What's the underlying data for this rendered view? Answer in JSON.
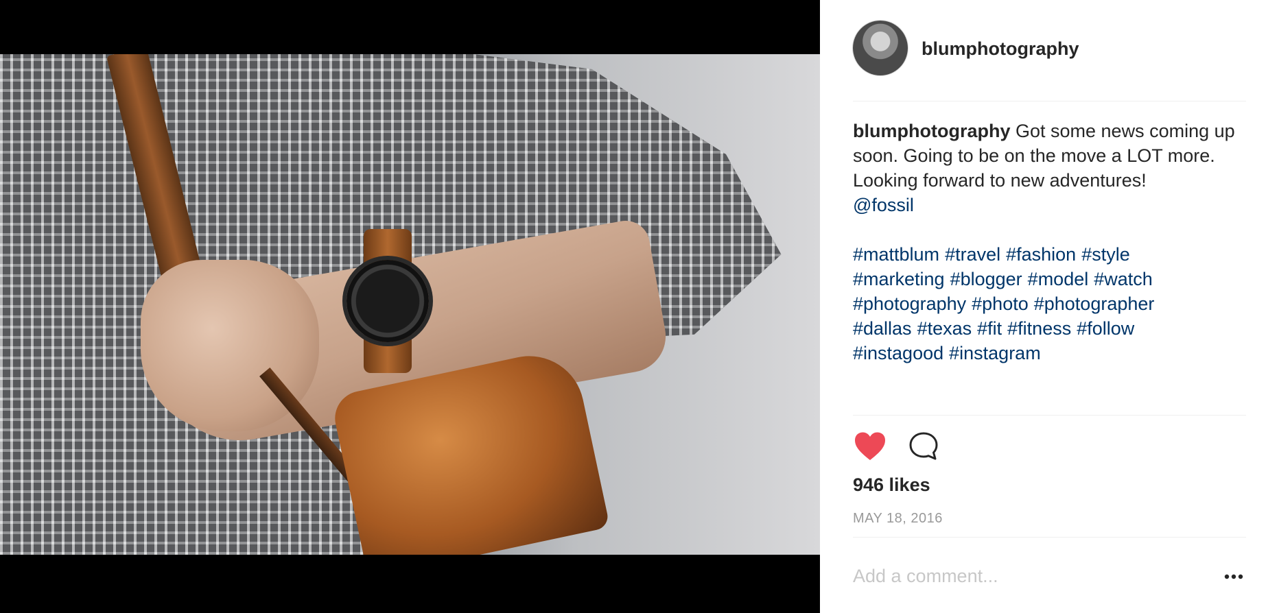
{
  "post": {
    "username": "blumphotography",
    "caption": {
      "username": "blumphotography",
      "text": "Got some news coming up soon. Going to be on the move a LOT more. Looking forward to new adventures!",
      "mention": "@fossil",
      "hashtags": [
        "#mattblum",
        "#travel",
        "#fashion",
        "#style",
        "#marketing",
        "#blogger",
        "#model",
        "#watch",
        "#photography",
        "#photo",
        "#photographer",
        "#dallas",
        "#texas",
        "#fit",
        "#fitness",
        "#follow",
        "#instagood",
        "#instagram"
      ]
    },
    "likes": "946 likes",
    "date": "MAY 18, 2016"
  },
  "actions": {
    "like_icon": "heart-icon",
    "comment_icon": "comment-icon",
    "more_icon": "more-options-icon"
  },
  "comment": {
    "placeholder": "Add a comment..."
  },
  "colors": {
    "link": "#003569",
    "heart": "#ed4956",
    "muted": "#999999",
    "placeholder": "#c7c7c7"
  }
}
